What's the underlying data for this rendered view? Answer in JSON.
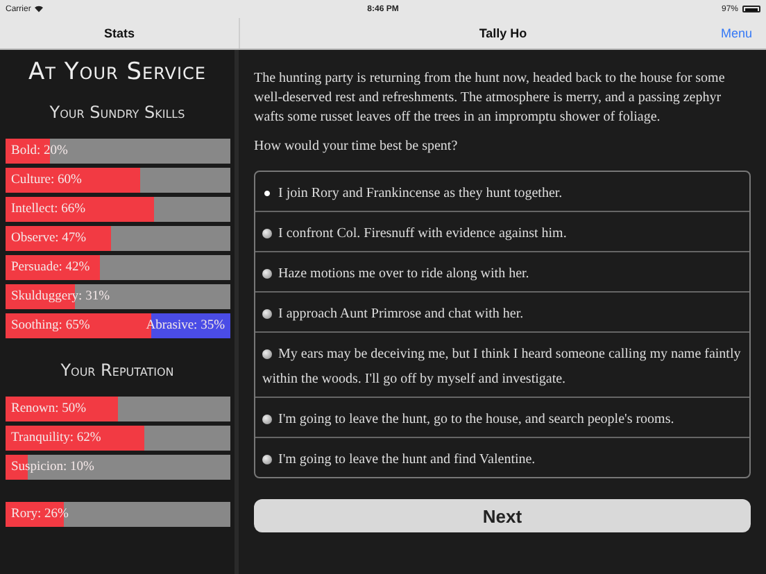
{
  "status_bar": {
    "carrier": "Carrier",
    "time": "8:46 PM",
    "battery": "97%"
  },
  "nav": {
    "left_title": "Stats",
    "title": "Tally Ho",
    "menu": "Menu"
  },
  "sidebar": {
    "title": "At Your Service",
    "sections": [
      {
        "heading": "Your Sundry Skills",
        "groups": [
          [
            {
              "kind": "single",
              "label": "Bold: 20%",
              "level": 0.2
            },
            {
              "kind": "single",
              "label": "Culture: 60%",
              "level": 0.6
            },
            {
              "kind": "single",
              "label": "Intellect: 66%",
              "level": 0.66
            },
            {
              "kind": "single",
              "label": "Observe: 47%",
              "level": 0.47
            },
            {
              "kind": "single",
              "label": "Persuade: 42%",
              "level": 0.42
            },
            {
              "kind": "single",
              "label": "Skulduggery: 31%",
              "level": 0.31
            },
            {
              "kind": "opposed",
              "label": "Soothing: 65%",
              "right_label": "Abrasive: 35%",
              "level": 0.65
            }
          ]
        ]
      },
      {
        "heading": "Your Reputation",
        "groups": [
          [
            {
              "kind": "single",
              "label": "Renown: 50%",
              "level": 0.5
            },
            {
              "kind": "single",
              "label": "Tranquility: 62%",
              "level": 0.62
            },
            {
              "kind": "single",
              "label": "Suspicion: 10%",
              "level": 0.1
            }
          ],
          [
            {
              "kind": "single",
              "label": "Rory: 26%",
              "level": 0.26
            }
          ]
        ]
      }
    ]
  },
  "story": {
    "text": "The hunting party is returning from the hunt now, headed back to the house for some well-deserved rest and refreshments. The atmosphere is merry, and a passing zephyr wafts some russet leaves off the trees in an impromptu shower of foliage.",
    "question": "How would your time best be spent?"
  },
  "choices": [
    {
      "label": "I join Rory and Frankincense as they hunt together.",
      "selected": true
    },
    {
      "label": "I confront Col. Firesnuff with evidence against him.",
      "selected": false
    },
    {
      "label": "Haze motions me over to ride along with her.",
      "selected": false
    },
    {
      "label": "I approach Aunt Primrose and chat with her.",
      "selected": false
    },
    {
      "label": "My ears may be deceiving me, but I think I heard someone calling my name faintly within the woods. I'll go off by myself and investigate.",
      "selected": false
    },
    {
      "label": "I'm going to leave the hunt, go to the house, and search people's rooms.",
      "selected": false
    },
    {
      "label": "I'm going to leave the hunt and find Valentine.",
      "selected": false
    }
  ],
  "next_button": "Next"
}
